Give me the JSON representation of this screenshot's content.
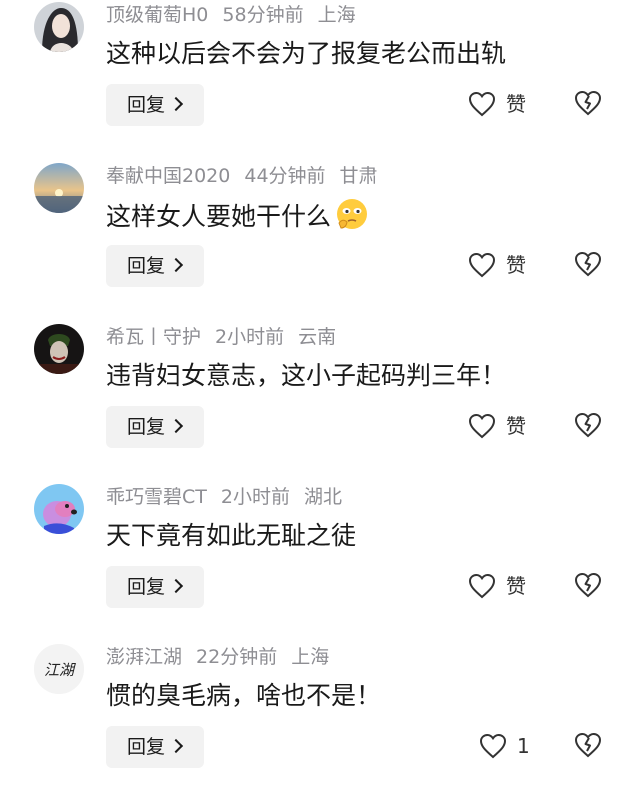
{
  "comments": [
    {
      "username": "顶级葡萄H0",
      "time": "58分钟前",
      "location": "上海",
      "text": "这种以后会不会为了报复老公而出轨",
      "reply_label": "回复",
      "like_label": "赞"
    },
    {
      "username": "奉献中国2020",
      "time": "44分钟前",
      "location": "甘肃",
      "text": "这样女人要她干什么",
      "reply_label": "回复",
      "like_label": "赞"
    },
    {
      "username": "希瓦丨守护",
      "time": "2小时前",
      "location": "云南",
      "text": "违背妇女意志，这小子起码判三年！",
      "reply_label": "回复",
      "like_label": "赞"
    },
    {
      "username": "乖巧雪碧CT",
      "time": "2小时前",
      "location": "湖北",
      "text": "天下竟有如此无耻之徒",
      "reply_label": "回复",
      "like_label": "赞"
    },
    {
      "username": "澎湃江湖",
      "time": "22分钟前",
      "location": "上海",
      "text": "惯的臭毛病，啥也不是！",
      "reply_label": "回复",
      "like_label": "1",
      "avatar_text": "江湖"
    }
  ]
}
